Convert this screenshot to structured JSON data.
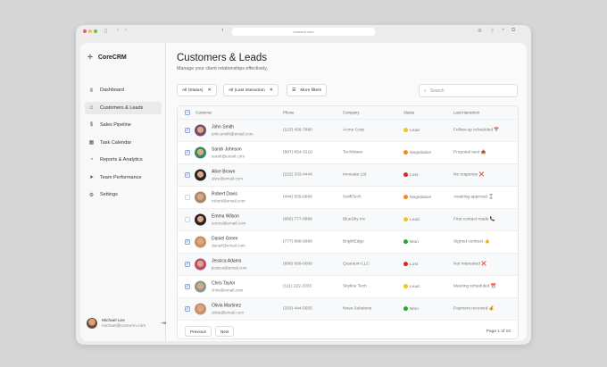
{
  "browser": {
    "url": "corecrm.com"
  },
  "app": {
    "name": "CoreCRM"
  },
  "sidebar": {
    "items": [
      {
        "label": "Dashboard",
        "icon": "bar-chart-icon",
        "glyph": "Ⅱ"
      },
      {
        "label": "Customers & Leads",
        "icon": "users-icon",
        "glyph": "☺",
        "active": true
      },
      {
        "label": "Sales Pipeline",
        "icon": "dollar-icon",
        "glyph": "$"
      },
      {
        "label": "Task Calendar",
        "icon": "calendar-icon",
        "glyph": "▦"
      },
      {
        "label": "Reports & Analytics",
        "icon": "pie-chart-icon",
        "glyph": "◔"
      },
      {
        "label": "Team Performance",
        "icon": "rocket-icon",
        "glyph": "➤"
      },
      {
        "label": "Settings",
        "icon": "gear-icon",
        "glyph": "⚙"
      }
    ],
    "user": {
      "name": "Michael Lee",
      "email": "michael@corecrm.com"
    }
  },
  "header": {
    "title": "Customers & Leads",
    "subtitle": "Manage your client relationships effectively."
  },
  "filters": {
    "status": "All (Status)",
    "last": "All (Last interaction",
    "more": "More filters",
    "search_placeholder": "Search"
  },
  "table": {
    "columns": [
      "Customer",
      "Phone",
      "Company",
      "Status",
      "Last interaction"
    ],
    "rows": [
      {
        "name": "John Smith",
        "email": "john.smith@email.com",
        "phone": "(123) 456-7890",
        "company": "Acme Corp",
        "status": "Lead",
        "last": "Follow-up scheduled 📅",
        "checked": true
      },
      {
        "name": "Sarah Johnson",
        "email": "sarah@email.com",
        "phone": "(987) 654-3210",
        "company": "TechWave",
        "status": "Negotiation",
        "last": "Proposal sent 📤",
        "checked": true
      },
      {
        "name": "Alice Brown",
        "email": "alice@email.com",
        "phone": "(222) 333-4444",
        "company": "Innovate Ltd",
        "status": "Lost",
        "last": "No response ❌",
        "checked": true
      },
      {
        "name": "Robert Davis",
        "email": "robert@email.com",
        "phone": "(444) 555-6666",
        "company": "SwiftTech",
        "status": "Negotiation",
        "last": "Awaiting approval ⌛",
        "checked": false
      },
      {
        "name": "Emma Wilson",
        "email": "emma@email.com",
        "phone": "(666) 777-8888",
        "company": "BlueSky Inc",
        "status": "Lead",
        "last": "First contact made 📞",
        "checked": false
      },
      {
        "name": "Daniel Green",
        "email": "daniel@email.com",
        "phone": "(777) 888-9999",
        "company": "BrightEdge",
        "status": "Won",
        "last": "Signed contract 👍",
        "checked": true
      },
      {
        "name": "Jessica Adams",
        "email": "jessica@email.com",
        "phone": "(888) 999-0000",
        "company": "Quantum LLC",
        "status": "Lost",
        "last": "Not interested ❌",
        "checked": true
      },
      {
        "name": "Chris Taylor",
        "email": "chris@email.com",
        "phone": "(111) 222-3333",
        "company": "Skyline Tech",
        "status": "Lead",
        "last": "Meeting scheduled 📆",
        "checked": true
      },
      {
        "name": "Olivia Martinez",
        "email": "olivia@email.com",
        "phone": "(333) 444-5555",
        "company": "Nova Solutions",
        "status": "Won",
        "last": "Payment received 💰",
        "checked": true
      }
    ]
  },
  "status_colors": {
    "Lead": "#f2c12e",
    "Negotiation": "#f08a24",
    "Lost": "#d42a2a",
    "Won": "#2aa52a"
  },
  "pagination": {
    "previous": "Previous",
    "next": "Next",
    "page": "Page 1 of 10"
  }
}
